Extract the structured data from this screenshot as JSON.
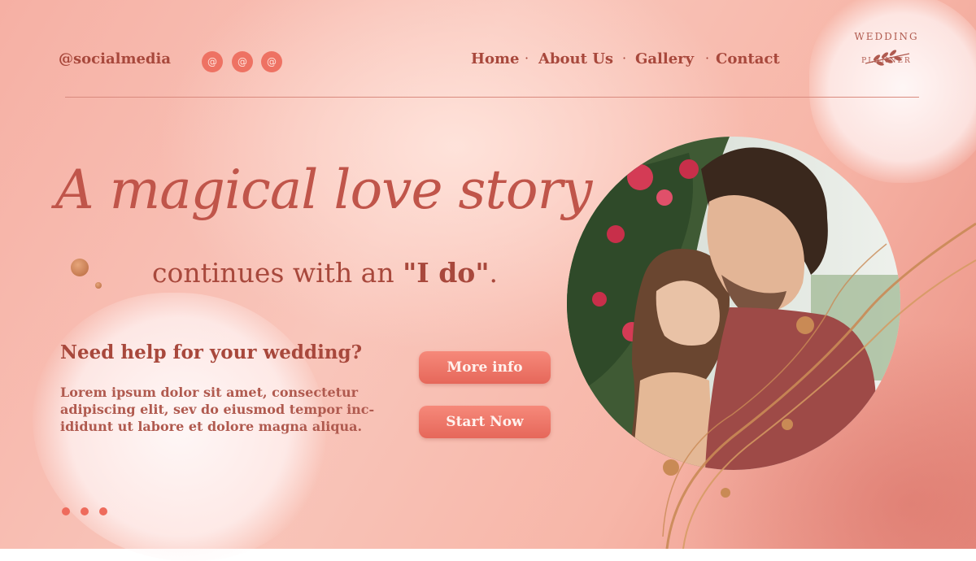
{
  "header": {
    "handle": "@socialmedia",
    "social_icons": [
      "@",
      "@",
      "@"
    ],
    "nav": [
      "Home",
      "About Us",
      "Gallery",
      "Contact"
    ],
    "nav_separator": "·"
  },
  "logo": {
    "top": "WEDDING",
    "bottom": "PLANNER",
    "icon": "branch-icon"
  },
  "hero": {
    "headline": "A magical love story",
    "subline_prefix": "continues with an ",
    "subline_bold": "\"I do\"",
    "subline_suffix": "."
  },
  "info": {
    "heading": "Need help for your wedding?",
    "body": "Lorem ipsum dolor sit amet, consectetur adipiscing elit, sev do eiusmod tempor inc-ididunt ut labore et dolore magna aliqua."
  },
  "buttons": {
    "more": "More info",
    "start": "Start Now"
  },
  "pager": {
    "count": 3
  },
  "colors": {
    "accent": "#ee7263",
    "text": "#a8483c",
    "headline": "#c0554a",
    "gold": "#c98a55"
  }
}
